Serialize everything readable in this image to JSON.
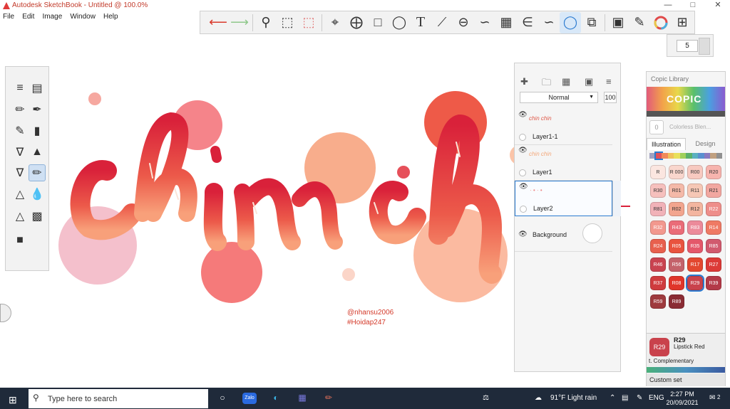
{
  "window": {
    "title": "Autodesk SketchBook - Untitled @ 100.0%",
    "controls": [
      "—",
      "□",
      "✕"
    ]
  },
  "menu": [
    "File",
    "Edit",
    "Image",
    "Window",
    "Help"
  ],
  "toolbar": {
    "icons": [
      "undo-icon",
      "redo-icon",
      "zoom-icon",
      "rect-select-icon",
      "lasso-select-icon",
      "crop-icon",
      "transform-icon",
      "distort-icon",
      "fill-icon",
      "text-icon",
      "ruler-icon",
      "ellipse-guide-icon",
      "french-curve-icon",
      "perspective-icon",
      "symmetry-icon",
      "stroke-icon",
      "brush-icon",
      "layer-editor-icon",
      "copic-icon",
      "pencil-case-icon",
      "color-wheel-icon",
      "brush-library-icon"
    ],
    "active": "brush-icon"
  },
  "brush_size": {
    "value": "5"
  },
  "brushes": {
    "active_index": 7
  },
  "layers": {
    "blend_mode": "Normal",
    "opacity": "100",
    "items": [
      {
        "name": "Layer1-1",
        "thumb": "chin chin"
      },
      {
        "name": "Layer1",
        "thumb": "chin chin"
      },
      {
        "name": "Layer2",
        "thumb": ""
      },
      {
        "name": "Background",
        "thumb": ""
      }
    ]
  },
  "canvas": {
    "signature_line1": "@nhansu2006",
    "signature_line2": "#Hoidap247",
    "lettering_color": "#e0313a",
    "accent_colors": [
      "#f08a8a",
      "#f4a87a",
      "#f6b4c8",
      "#fdc6a8"
    ]
  },
  "copic": {
    "title": "Copic Library",
    "logo": "COPIC",
    "colorless": "0",
    "colorless_label": "Colorless Blen...",
    "tabs": [
      "Illustration",
      "Design"
    ],
    "chips": [
      {
        "code": "R 0000",
        "color": "#fbe6e0",
        "light": true
      },
      {
        "code": "R 000",
        "color": "#f9d6cd",
        "light": true
      },
      {
        "code": "R00",
        "color": "#f7c9c0",
        "light": true
      },
      {
        "code": "R20",
        "color": "#f7b4ae",
        "light": true
      },
      {
        "code": "R30",
        "color": "#f6c0bd",
        "light": true
      },
      {
        "code": "R01",
        "color": "#f4b9a8",
        "light": true
      },
      {
        "code": "R11",
        "color": "#f6c7b5",
        "light": true
      },
      {
        "code": "R21",
        "color": "#f2a7a0",
        "light": true
      },
      {
        "code": "R81",
        "color": "#f1b2b8",
        "light": true
      },
      {
        "code": "R02",
        "color": "#f2a58e",
        "light": true
      },
      {
        "code": "R12",
        "color": "#f3b59f",
        "light": true
      },
      {
        "code": "R22",
        "color": "#ee8e8a",
        "light": false
      },
      {
        "code": "R32",
        "color": "#f2988e",
        "light": false
      },
      {
        "code": "R43",
        "color": "#ea6c78",
        "light": false
      },
      {
        "code": "R83",
        "color": "#ec8a9a",
        "light": false
      },
      {
        "code": "R14",
        "color": "#ef7a64",
        "light": false
      },
      {
        "code": "R24",
        "color": "#e8604e",
        "light": false
      },
      {
        "code": "R05",
        "color": "#e9533f",
        "light": false
      },
      {
        "code": "R35",
        "color": "#e4586a",
        "light": false
      },
      {
        "code": "R85",
        "color": "#d15a6e",
        "light": false
      },
      {
        "code": "R46",
        "color": "#c94350",
        "light": false
      },
      {
        "code": "R56",
        "color": "#c4626a",
        "light": false
      },
      {
        "code": "R17",
        "color": "#e3482f",
        "light": false
      },
      {
        "code": "R27",
        "color": "#dc3a37",
        "light": false
      },
      {
        "code": "R37",
        "color": "#cf3b3e",
        "light": false
      },
      {
        "code": "R08",
        "color": "#e0352a",
        "light": false
      },
      {
        "code": "R29",
        "color": "#c9424c",
        "light": false
      },
      {
        "code": "R39",
        "color": "#b33a48",
        "light": false
      },
      {
        "code": "R59",
        "color": "#9e3a3e",
        "light": false
      },
      {
        "code": "R89",
        "color": "#8a2c34",
        "light": false
      }
    ],
    "selected_code": "R29",
    "selected_name": "Lipstick Red",
    "complementary": "t. Complementary",
    "custom_set": "Custom set"
  },
  "taskbar": {
    "search_placeholder": "Type here to search",
    "weather": "91°F  Light rain",
    "language": "ENG",
    "time": "2:27 PM",
    "date": "20/09/2021",
    "notifications": "2"
  }
}
